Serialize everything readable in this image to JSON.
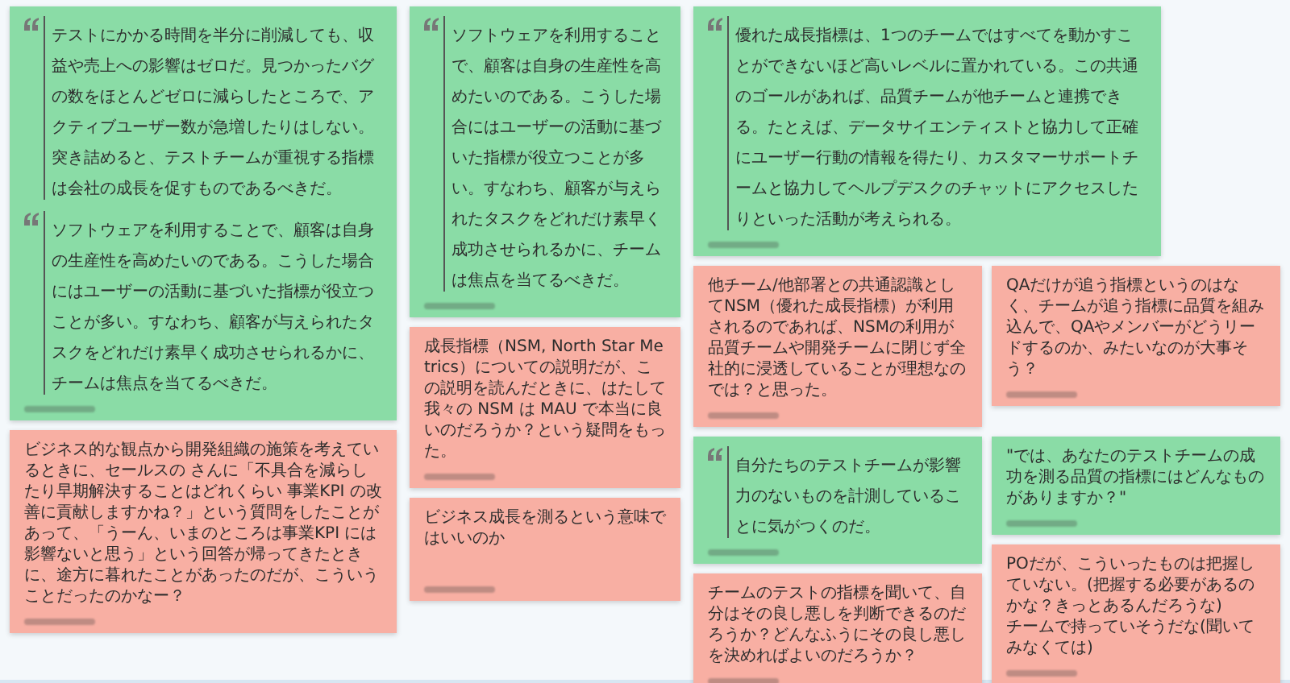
{
  "notes": [
    {
      "kind": "quote",
      "color": "#8adca6",
      "paragraphs": [
        "テストにかかる時間を半分に削減しても、収益や売上への影響はゼロだ。見つかったバグの数をほとんどゼロに減らしたところで、アクティブユーザー数が急増したりはしない。突き詰めると、テストチームが重視する指標は会社の成長を促すものであるべきだ。",
        "ソフトウェアを利用することで、顧客は自身の生産性を高めたいのである。こうした場合にはユーザーの活動に基づいた指標が役立つことが多い。すなわち、顧客が与えられたタスクをどれだけ素早く成功させられるかに、チームは焦点を当てるべきだ。"
      ]
    },
    {
      "kind": "comment",
      "color": "#f8afa3",
      "paragraphs": [
        "ビジネス的な観点から開発組織の施策を考えているときに、セールスの さんに「不具合を減らしたり早期解決することはどれくらい 事業KPI の改善に貢献しますかね？」という質問をしたことがあって、「うーん、いまのところは事業KPI には影響ないと思う」という回答が帰ってきたときに、途方に暮れたことがあったのだが、こういうことだったのかなー？"
      ]
    },
    {
      "kind": "quote",
      "color": "#8adca6",
      "paragraphs": [
        "ソフトウェアを利用することで、顧客は自身の生産性を高めたいのである。こうした場合にはユーザーの活動に基づいた指標が役立つことが多い。すなわち、顧客が与えられたタスクをどれだけ素早く成功させられるかに、チームは焦点を当てるべきだ。"
      ]
    },
    {
      "kind": "comment",
      "color": "#f8afa3",
      "paragraphs": [
        "成長指標（NSM, North Star Metrics）についての説明だが、この説明を読んだときに、はたして我々の NSM は MAU で本当に良いのだろうか？という疑問をもった。"
      ]
    },
    {
      "kind": "comment",
      "color": "#f8afa3",
      "paragraphs": [
        "ビジネス成長を測るという意味ではいいのか"
      ]
    },
    {
      "kind": "quote",
      "color": "#8adca6",
      "paragraphs": [
        "優れた成長指標は、1つのチームではすべてを動かすことができないほど高いレベルに置かれている。この共通のゴールがあれば、品質チームが他チームと連携できる。たとえば、データサイエンティストと協力して正確にユーザー行動の情報を得たり、カスタマーサポートチームと協力してヘルプデスクのチャットにアクセスしたりといった活動が考えられる。"
      ]
    },
    {
      "kind": "comment",
      "color": "#f8afa3",
      "paragraphs": [
        "他チーム/他部署との共通認識としてNSM（優れた成長指標）が利用されるのであれば、NSMの利用が品質チームや開発チームに閉じず全社的に浸透していることが理想なのでは？と思った。"
      ]
    },
    {
      "kind": "comment",
      "color": "#f8afa3",
      "paragraphs": [
        "QAだけが追う指標というのはなく、チームが追う指標に品質を組み込んで、QAやメンバーがどうリードするのか、みたいなのが大事そう？"
      ]
    },
    {
      "kind": "quote",
      "color": "#8adca6",
      "paragraphs": [
        "自分たちのテストチームが影響力のないものを計測していることに気がつくのだ。"
      ]
    },
    {
      "kind": "comment",
      "color": "#f8afa3",
      "paragraphs": [
        "チームのテストの指標を聞いて、自分はその良し悪しを判断できるのだろうか？どんなふうにその良し悪しを決めればよいのだろうか？"
      ]
    },
    {
      "kind": "comment",
      "color": "#8adca6",
      "paragraphs": [
        "\"では、あなたのテストチームの成功を測る品質の指標にはどんなものがありますか？\""
      ]
    },
    {
      "kind": "comment",
      "color": "#f8afa3",
      "paragraphs": [
        "POだが、こういったものは把握していない。(把握する必要があるのかな？きっとあるんだろうな)\nチームで持っていそうだな(聞いてみなくては)"
      ]
    }
  ]
}
